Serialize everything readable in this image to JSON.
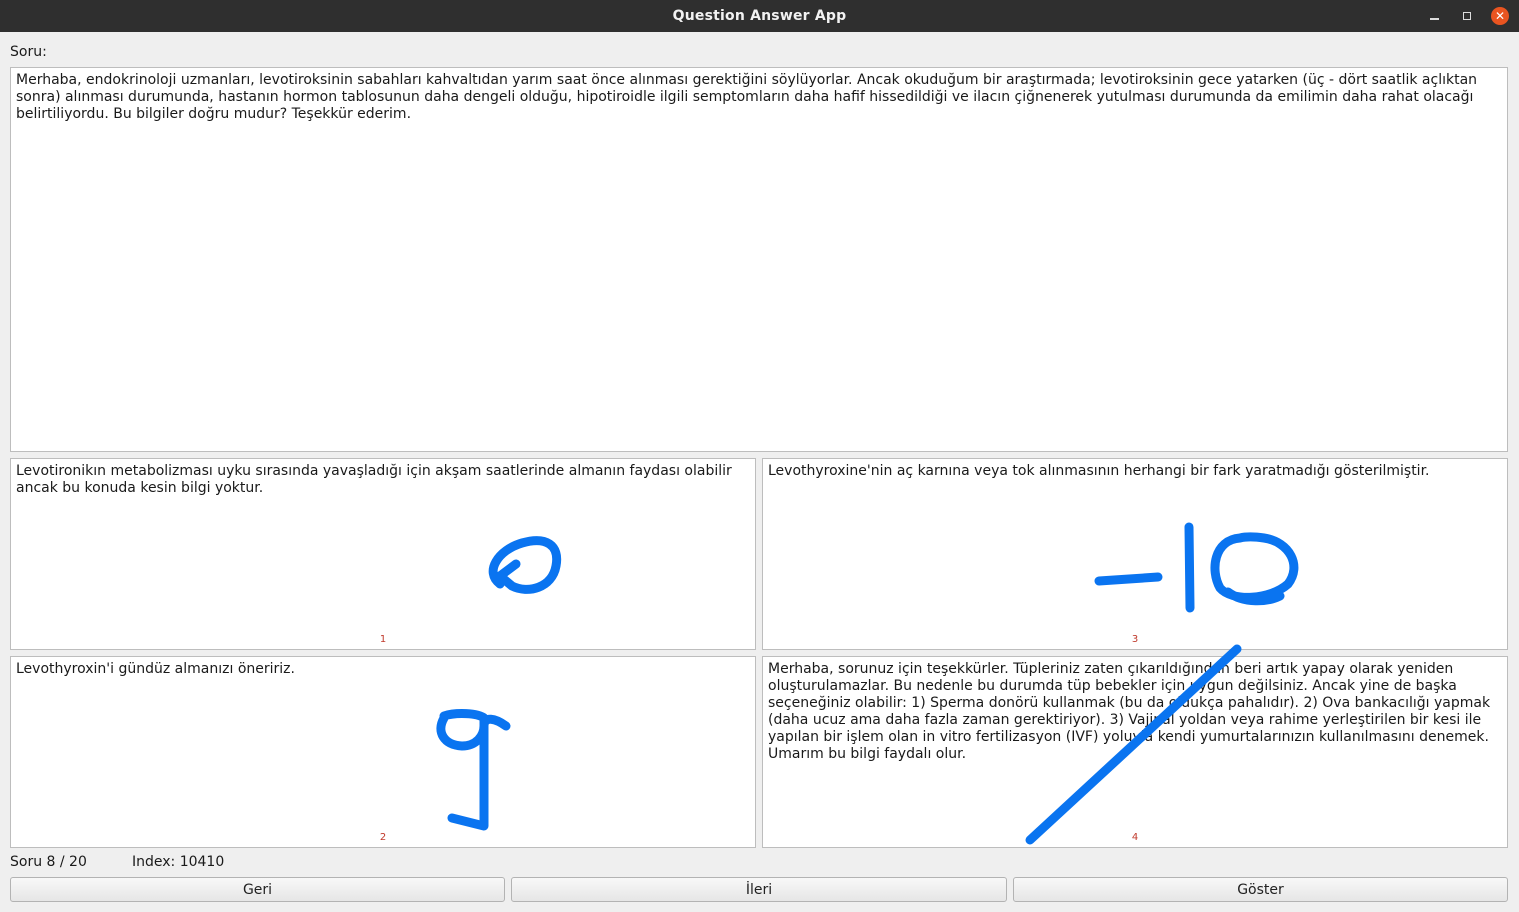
{
  "window": {
    "title": "Question Answer App"
  },
  "question": {
    "label": "Soru:",
    "text": "Merhaba, endokrinoloji uzmanları, levotiroksinin sabahları kahvaltıdan yarım saat önce alınması gerektiğini söylüyorlar. Ancak okuduğum bir araştırmada; levotiroksinin gece yatarken (üç - dört saatlik açlıktan sonra) alınması durumunda, hastanın hormon tablosunun daha dengeli olduğu, hipotiroidle ilgili semptomların daha hafif hissedildiği ve ilacın çiğnenerek yutulması durumunda da emilimin daha rahat olacağı belirtiliyordu. Bu bilgiler doğru mudur? Teşekkür ederim."
  },
  "answers": [
    {
      "number": "1",
      "text": "Levotironikın metabolizması uyku sırasında yavaşladığı için akşam saatlerinde almanın faydası olabilir ancak bu konuda kesin bilgi yoktur.",
      "handwritten_score": "0"
    },
    {
      "number": "2",
      "text": "Levothyroxin'i gündüz almanızı öneririz.",
      "handwritten_score": "9"
    },
    {
      "number": "3",
      "text": "Levothyroxine'nin aç karnına veya tok alınmasının herhangi bir fark yaratmadığı gösterilmiştir.",
      "handwritten_score": "-10"
    },
    {
      "number": "4",
      "text": "Merhaba, sorunuz için teşekkürler. Tüpleriniz zaten çıkarıldığından beri artık yapay olarak yeniden oluşturulamazlar. Bu nedenle bu durumda tüp bebekler için uygun değilsiniz. Ancak yine de başka seçeneğiniz olabilir: 1) Sperma donörü kullanmak (bu da oldukça pahalıdır). 2) Ova bankacılığı yapmak (daha ucuz ama daha fazla zaman gerektiriyor). 3) Vajinal yoldan veya rahime yerleştirilen bir kesi ile yapılan bir işlem olan in vitro fertilizasyon (IVF) yoluyla kendi yumurtalarınızın kullanılmasını denemek. Umarım bu bilgi faydalı olur.",
      "handwritten_score": "/"
    }
  ],
  "status": {
    "progress": "Soru 8 / 20",
    "index": "Index: 10410"
  },
  "buttons": {
    "back": "Geri",
    "next": "İleri",
    "show": "Göster"
  },
  "colors": {
    "titlebar": "#2f2f2f",
    "close_button": "#e95420",
    "ink": "#0a74f0",
    "number_label": "#c0392b"
  },
  "icons": {
    "minimize": "minimize-icon",
    "maximize": "maximize-icon",
    "close": "close-icon"
  }
}
